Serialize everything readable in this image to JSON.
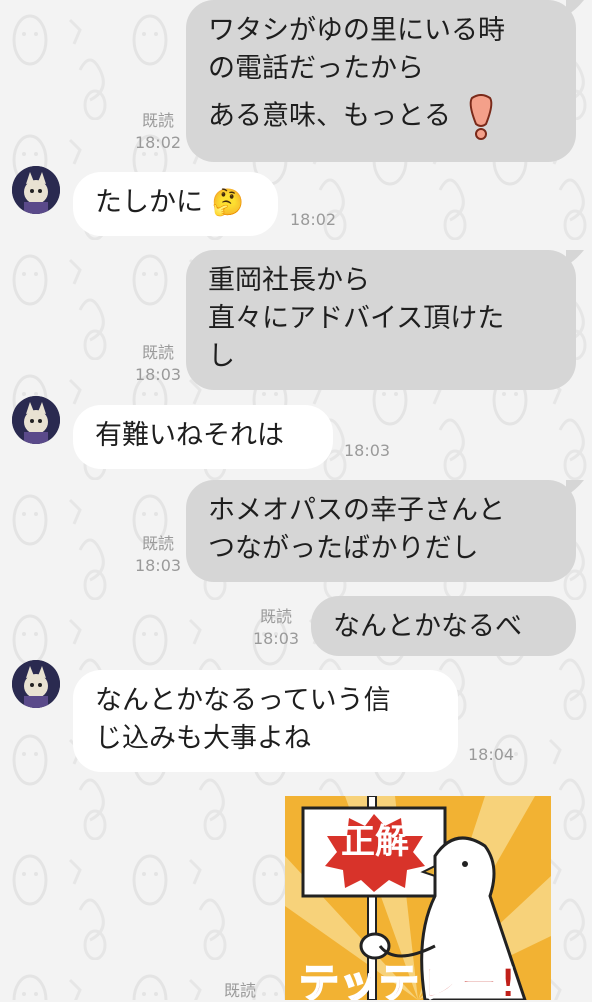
{
  "chat": {
    "read_label": "既読",
    "messages": [
      {
        "id": "m1",
        "side": "out",
        "lines": [
          "ワタシがゆの里にいる時",
          "の電話だったから",
          "ある意味、もっとる"
        ],
        "emoji": "exclamation-mark",
        "time": "18:02",
        "read": true
      },
      {
        "id": "m2",
        "side": "in",
        "lines": [
          "たしかに"
        ],
        "emoji": "thinking-face",
        "time": "18:02"
      },
      {
        "id": "m3",
        "side": "out",
        "lines": [
          "重岡社長から",
          "直々にアドバイス頂けた",
          "し"
        ],
        "time": "18:03",
        "read": true
      },
      {
        "id": "m4",
        "side": "in",
        "lines": [
          "有難いねそれは"
        ],
        "time": "18:03"
      },
      {
        "id": "m5",
        "side": "out",
        "lines": [
          "ホメオパスの幸子さんと",
          "つながったばかりだし"
        ],
        "time": "18:03",
        "read": true
      },
      {
        "id": "m6",
        "side": "out",
        "lines": [
          "なんとかなるべ"
        ],
        "time": "18:03",
        "read": true
      },
      {
        "id": "m7",
        "side": "in",
        "lines": [
          "なんとかなるっていう信",
          "じ込みも大事よね"
        ],
        "time": "18:04"
      },
      {
        "id": "m8",
        "side": "out",
        "type": "sticker",
        "sticker_sign": "正解",
        "sticker_banner": "テッテレー!",
        "read": true
      }
    ]
  },
  "colors": {
    "background": "#f3f3f3",
    "outgoing": "#d6d6d6",
    "incoming": "#ffffff",
    "meta_text": "#9a9a9a",
    "sticker_bg": "#f2b233",
    "sticker_sign_red": "#d8332a"
  }
}
